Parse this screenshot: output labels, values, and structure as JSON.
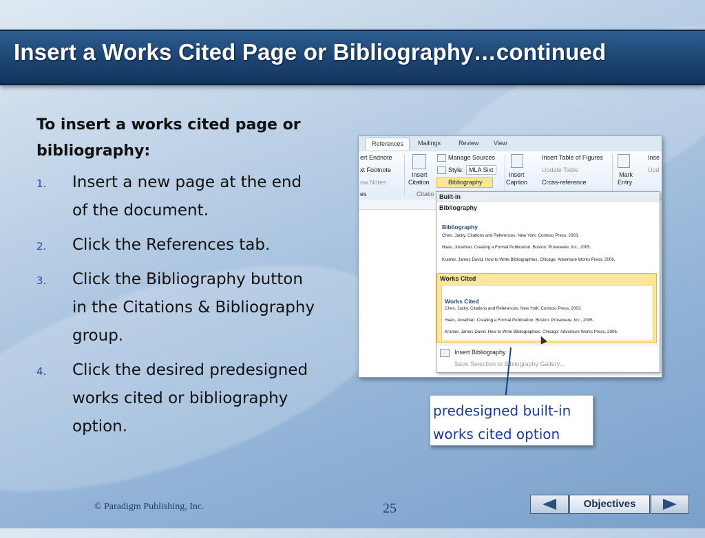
{
  "slide": {
    "title": "Insert a Works Cited Page or Bibliography…continued",
    "intro": "To insert a works cited page or bibliography:",
    "steps": [
      {
        "num": "1.",
        "text": "Insert a new page at the end of the document."
      },
      {
        "num": "2.",
        "text": "Click the References tab."
      },
      {
        "num": "3.",
        "text": "Click the Bibliography button in the Citations & Bibliography group."
      },
      {
        "num": "4.",
        "text": "Click the desired predesigned works cited or bibliography option."
      }
    ]
  },
  "screenshot": {
    "tabs": [
      "References",
      "Mailings",
      "Review",
      "View"
    ],
    "active_tab": "References",
    "ribbon": {
      "endnote": "ert Endnote",
      "footnote": "xt Footnote",
      "show_notes": "ow Notes",
      "insert_citation_1": "Insert",
      "insert_citation_2": "Citation",
      "manage_sources": "Manage Sources",
      "style_label": "Style:",
      "style_value": "MLA Sixt",
      "bibliography": "Bibliography",
      "citations_group": "Citatio",
      "insert_caption_1": "Insert",
      "insert_caption_2": "Caption",
      "insert_table_of_figures": "Insert Table of Figures",
      "update_table": "Update Table",
      "cross_reference": "Cross-reference",
      "mark_entry_1": "Mark",
      "mark_entry_2": "Entry",
      "ins_index": "Inse",
      "upd_index": "Upd",
      "es_fragment": "es"
    },
    "dropdown": {
      "builtin_header": "Built-In",
      "bibliography_label": "Bibliography",
      "bib_title": "Bibliography",
      "bib_entries": [
        "Chen, Jacky. Citations and References. New York: Contoso Press, 2003.",
        "Haas, Jonathan. Creating a Formal Publication. Boston: Proseware, Inc., 2005.",
        "Kramer, James David. How to Write Bibliographies. Chicago: Adventure Works Press, 2006."
      ],
      "works_cited_label": "Works Cited",
      "wc_title": "Works Cited",
      "wc_entries": [
        "Chen, Jacky. Citations and References. New York: Contoso Press, 2003.",
        "Haas, Jonathan. Creating a Formal Publication. Boston: Proseware, Inc., 2005.",
        "Kramer, James David. How to Write Bibliographies. Chicago: Adventure Works Press, 2006."
      ],
      "insert_bibliography": "Insert Bibliography",
      "save_selection": "Save Selection to Bibliography Gallery..."
    }
  },
  "callout": {
    "line1": "predesigned built-in",
    "line2": "works cited option"
  },
  "footer": {
    "copyright": "© Paradigm Publishing, Inc.",
    "page_number": "25",
    "objectives_label": "Objectives"
  },
  "colors": {
    "title_bar": "#1c4472",
    "step_number": "#1f4f9e",
    "callout_text": "#1c3e90",
    "highlight": "#fde59a"
  },
  "icons": {
    "prev": "triangle-left-icon",
    "next": "triangle-right-icon"
  }
}
